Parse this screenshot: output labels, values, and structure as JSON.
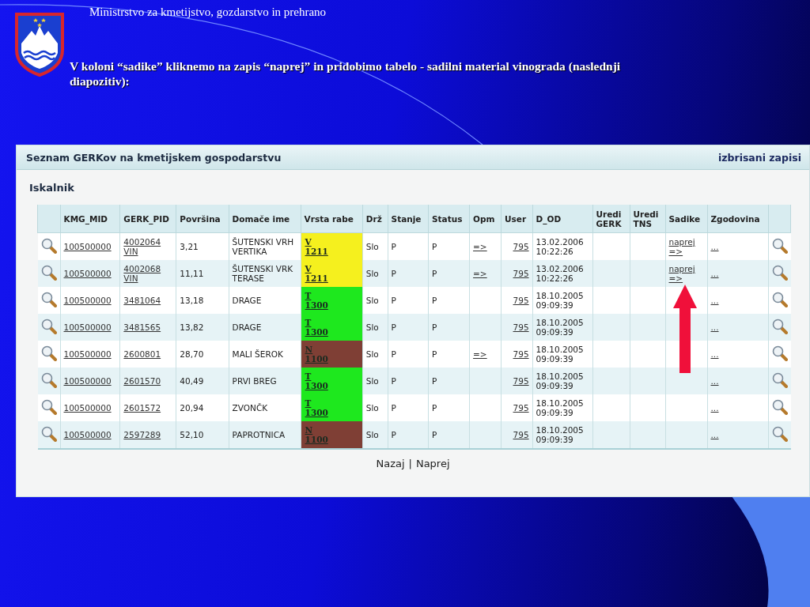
{
  "slide": {
    "organization": "Ministrstvo za kmetijstvo, gozdarstvo in prehrano",
    "caption": "V koloni “sadike” kliknemo na zapis “naprej” in pridobimo tabelo - sadilni material vinograda (naslednji diapozitiv):"
  },
  "panel": {
    "title": "Seznam GERKov na kmetijskem gospodarstvu",
    "header_link": "izbrisani zapisi",
    "section": "Iskalnik"
  },
  "table": {
    "columns": [
      "KMG_MID",
      "GERK_PID",
      "Površina",
      "Domače ime",
      "Vrsta rabe",
      "Drž",
      "Stanje",
      "Status",
      "Opm",
      "User",
      "D_OD",
      "Uredi GERK",
      "Uredi TNS",
      "Sadike",
      "Zgodovina"
    ],
    "rows": [
      {
        "kmg_mid": "100500000",
        "gerk_pid": "4002064",
        "gerk_suffix": "VIN",
        "area": "3,21",
        "name": "ŠUTENSKI VRH VERTIKA",
        "use_code": "V",
        "use_number": "1211",
        "color": "#f5f01e",
        "drz": "Slo",
        "stanje": "P",
        "status": "P",
        "opm": "=>",
        "user": "795",
        "date": "13.02.2006",
        "time": "10:22:26",
        "sadike": "naprej =>",
        "history": "..."
      },
      {
        "kmg_mid": "100500000",
        "gerk_pid": "4002068",
        "gerk_suffix": "VIN",
        "area": "11,11",
        "name": "ŠUTENSKI VRK TERASE",
        "use_code": "V",
        "use_number": "1211",
        "color": "#f5f01e",
        "drz": "Slo",
        "stanje": "P",
        "status": "P",
        "opm": "=>",
        "user": "795",
        "date": "13.02.2006",
        "time": "10:22:26",
        "sadike": "naprej =>",
        "history": "..."
      },
      {
        "kmg_mid": "100500000",
        "gerk_pid": "3481064",
        "area": "13,18",
        "name": "DRAGE",
        "use_code": "T",
        "use_number": "1300",
        "color": "#1ee81e",
        "drz": "Slo",
        "stanje": "P",
        "status": "P",
        "user": "795",
        "date": "18.10.2005",
        "time": "09:09:39",
        "history": "..."
      },
      {
        "kmg_mid": "100500000",
        "gerk_pid": "3481565",
        "area": "13,82",
        "name": "DRAGE",
        "use_code": "T",
        "use_number": "1300",
        "color": "#1ee81e",
        "drz": "Slo",
        "stanje": "P",
        "status": "P",
        "user": "795",
        "date": "18.10.2005",
        "time": "09:09:39",
        "history": "..."
      },
      {
        "kmg_mid": "100500000",
        "gerk_pid": "2600801",
        "area": "28,70",
        "name": "MALI ŠEROK",
        "use_code": "N",
        "use_number": "1100",
        "color": "#7f3f35",
        "drz": "Slo",
        "stanje": "P",
        "status": "P",
        "opm": "=>",
        "user": "795",
        "date": "18.10.2005",
        "time": "09:09:39",
        "history": "..."
      },
      {
        "kmg_mid": "100500000",
        "gerk_pid": "2601570",
        "area": "40,49",
        "name": "PRVI BREG",
        "use_code": "T",
        "use_number": "1300",
        "color": "#1ee81e",
        "drz": "Slo",
        "stanje": "P",
        "status": "P",
        "user": "795",
        "date": "18.10.2005",
        "time": "09:09:39",
        "history": "..."
      },
      {
        "kmg_mid": "100500000",
        "gerk_pid": "2601572",
        "area": "20,94",
        "name": "ZVONČK",
        "use_code": "T",
        "use_number": "1300",
        "color": "#1ee81e",
        "drz": "Slo",
        "stanje": "P",
        "status": "P",
        "user": "795",
        "date": "18.10.2005",
        "time": "09:09:39",
        "history": "..."
      },
      {
        "kmg_mid": "100500000",
        "gerk_pid": "2597289",
        "area": "52,10",
        "name": "PAPROTNICA",
        "use_code": "N",
        "use_number": "1100",
        "color": "#7f3f35",
        "drz": "Slo",
        "stanje": "P",
        "status": "P",
        "user": "795",
        "date": "18.10.2005",
        "time": "09:09:39",
        "history": "..."
      }
    ]
  },
  "pager": {
    "previous": "Nazaj",
    "separator": "|",
    "next": "Naprej"
  }
}
